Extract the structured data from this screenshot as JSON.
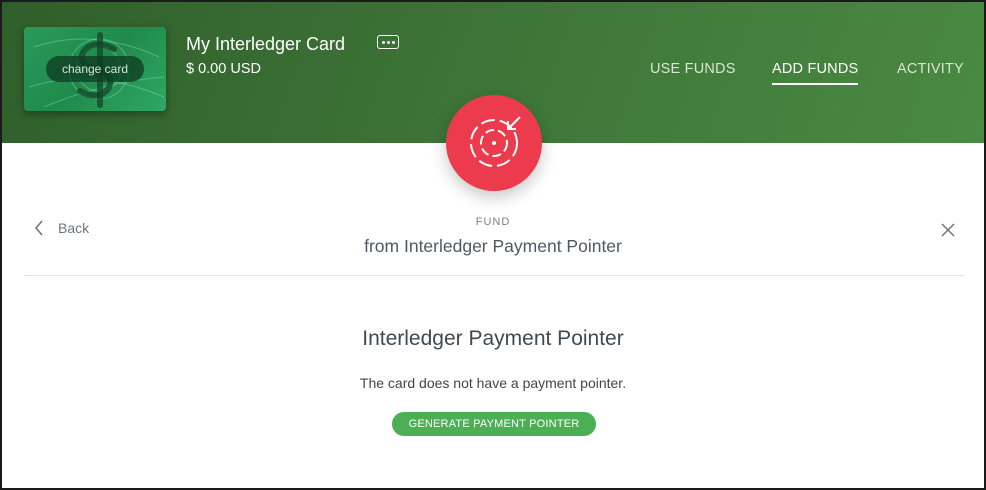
{
  "header": {
    "card_button": "change card",
    "card_title": "My Interledger Card",
    "balance": "$ 0.00 USD",
    "more_icon": "more-dots-icon",
    "nav": [
      {
        "label": "USE FUNDS",
        "active": false
      },
      {
        "label": "ADD FUNDS",
        "active": true
      },
      {
        "label": "ACTIVITY",
        "active": false
      }
    ],
    "colors": {
      "header_green": "#3d7337",
      "accent_red": "#ec3b4c"
    }
  },
  "fund": {
    "icon": "fund-target-icon",
    "back_label": "Back",
    "label": "FUND",
    "subtitle": "from Interledger Payment Pointer"
  },
  "main": {
    "title": "Interledger Payment Pointer",
    "message": "The card does not have a payment pointer.",
    "button": "GENERATE PAYMENT POINTER",
    "button_color": "#4caf55"
  }
}
